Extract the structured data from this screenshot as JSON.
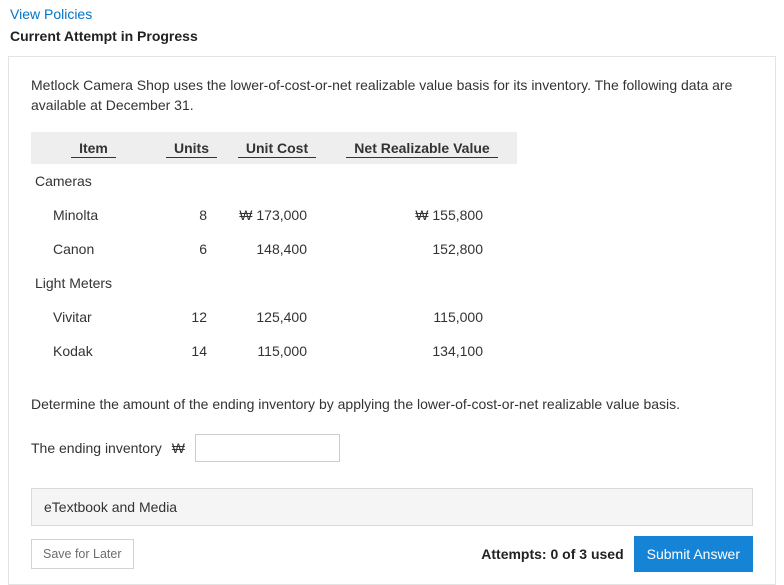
{
  "links": {
    "view_policies": "View Policies"
  },
  "heading": "Current Attempt in Progress",
  "problem_text": "Metlock Camera Shop uses the lower-of-cost-or-net realizable value basis for its inventory. The following data are available at December 31.",
  "table": {
    "headers": {
      "item": "Item",
      "units": "Units",
      "unit_cost": "Unit Cost",
      "nrv": "Net Realizable Value"
    },
    "currency": "₩",
    "categories": [
      {
        "name": "Cameras",
        "rows": [
          {
            "item": "Minolta",
            "units": "8",
            "unit_cost": "173,000",
            "nrv": "155,800",
            "show_currency": true
          },
          {
            "item": "Canon",
            "units": "6",
            "unit_cost": "148,400",
            "nrv": "152,800",
            "show_currency": false
          }
        ]
      },
      {
        "name": "Light Meters",
        "rows": [
          {
            "item": "Vivitar",
            "units": "12",
            "unit_cost": "125,400",
            "nrv": "115,000",
            "show_currency": false
          },
          {
            "item": "Kodak",
            "units": "14",
            "unit_cost": "115,000",
            "nrv": "134,100",
            "show_currency": false
          }
        ]
      }
    ]
  },
  "instruction": "Determine the amount of the ending inventory by applying the lower-of-cost-or-net realizable value basis.",
  "answer": {
    "label": "The ending inventory",
    "currency": "₩",
    "value": ""
  },
  "etextbook_label": "eTextbook and Media",
  "footer": {
    "save_label": "Save for Later",
    "attempts": "Attempts: 0 of 3 used",
    "submit_label": "Submit Answer"
  }
}
